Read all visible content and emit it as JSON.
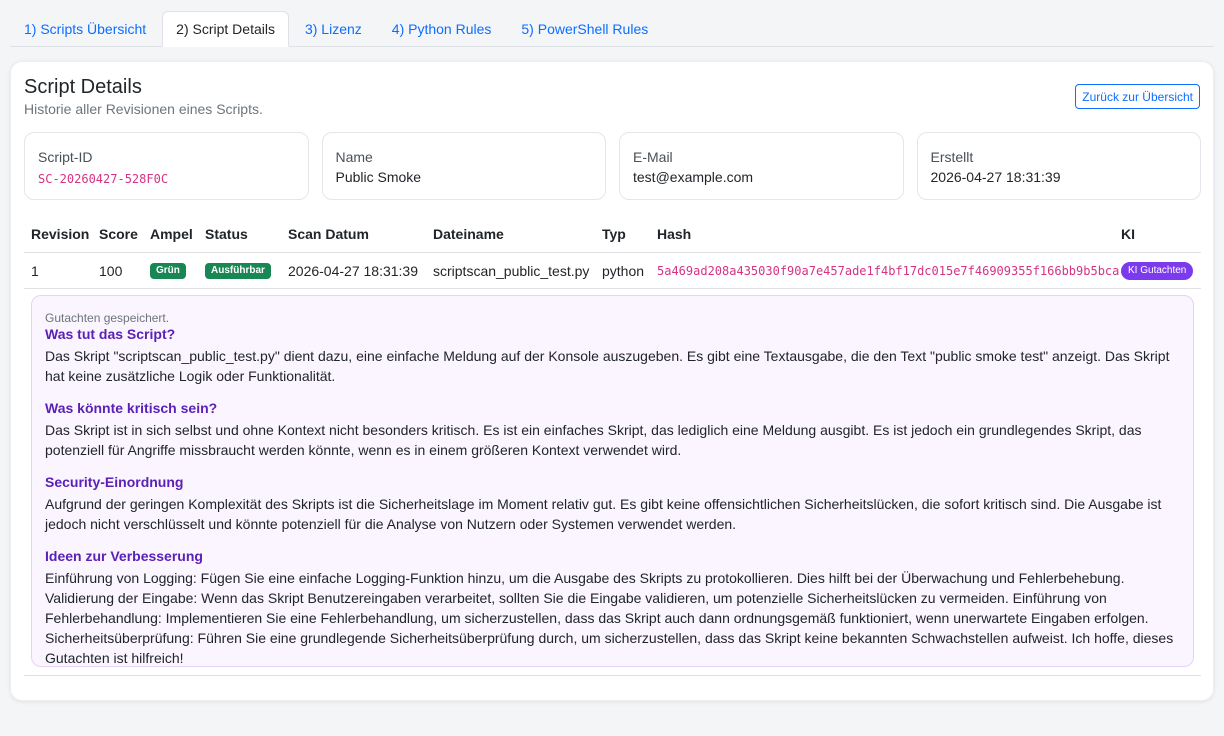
{
  "tabs": [
    {
      "label": "1) Scripts Übersicht",
      "active": false
    },
    {
      "label": "2) Script Details",
      "active": true
    },
    {
      "label": "3) Lizenz",
      "active": false
    },
    {
      "label": "4) Python Rules",
      "active": false
    },
    {
      "label": "5) PowerShell Rules",
      "active": false
    }
  ],
  "page": {
    "title": "Script Details",
    "subtitle": "Historie aller Revisionen eines Scripts.",
    "back_label": "Zurück zur Übersicht"
  },
  "info": {
    "script_id": {
      "label": "Script-ID",
      "value": "SC-20260427-528F0C"
    },
    "name": {
      "label": "Name",
      "value": "Public Smoke"
    },
    "email": {
      "label": "E-Mail",
      "value": "test@example.com"
    },
    "created": {
      "label": "Erstellt",
      "value": "2026-04-27 18:31:39"
    }
  },
  "table": {
    "headers": {
      "revision": "Revision",
      "score": "Score",
      "ampel": "Ampel",
      "status": "Status",
      "date": "Scan Datum",
      "file": "Dateiname",
      "typ": "Typ",
      "hash": "Hash",
      "ki": "KI"
    },
    "rows": [
      {
        "revision": "1",
        "score": "100",
        "ampel": "Grün",
        "status": "Ausführbar",
        "date": "2026-04-27 18:31:39",
        "file": "scriptscan_public_test.py",
        "typ": "python",
        "hash": "5a469ad208a435030f90a7e457ade1f4bf17dc015e7f46909355f166bb9b5bca",
        "ki": "KI Gutachten"
      }
    ]
  },
  "colors": {
    "accent": "#0d6efd",
    "ampel_green": "#198754",
    "ki_purple": "#7c3aed",
    "report_heading": "#5b21b6",
    "mono_pink": "#d63384"
  },
  "report": {
    "note": "Gutachten gespeichert.",
    "sections": [
      {
        "heading": "Was tut das Script?",
        "text": "Das Skript \"scriptscan_public_test.py\" dient dazu, eine einfache Meldung auf der Konsole auszugeben. Es gibt eine Textausgabe, die den Text \"public smoke test\" anzeigt. Das Skript hat keine zusätzliche Logik oder Funktionalität."
      },
      {
        "heading": "Was könnte kritisch sein?",
        "text": "Das Skript ist in sich selbst und ohne Kontext nicht besonders kritisch. Es ist ein einfaches Skript, das lediglich eine Meldung ausgibt. Es ist jedoch ein grundlegendes Skript, das potenziell für Angriffe missbraucht werden könnte, wenn es in einem größeren Kontext verwendet wird."
      },
      {
        "heading": "Security-Einordnung",
        "text": "Aufgrund der geringen Komplexität des Skripts ist die Sicherheitslage im Moment relativ gut. Es gibt keine offensichtlichen Sicherheitslücken, die sofort kritisch sind. Die Ausgabe ist jedoch nicht verschlüsselt und könnte potenziell für die Analyse von Nutzern oder Systemen verwendet werden."
      },
      {
        "heading": "Ideen zur Verbesserung",
        "text": "Einführung von Logging: Fügen Sie eine einfache Logging-Funktion hinzu, um die Ausgabe des Skripts zu protokollieren. Dies hilft bei der Überwachung und Fehlerbehebung. Validierung der Eingabe: Wenn das Skript Benutzereingaben verarbeitet, sollten Sie die Eingabe validieren, um potenzielle Sicherheitslücken zu vermeiden. Einführung von Fehlerbehandlung: Implementieren Sie eine Fehlerbehandlung, um sicherzustellen, dass das Skript auch dann ordnungsgemäß funktioniert, wenn unerwartete Eingaben erfolgen. Sicherheitsüberprüfung: Führen Sie eine grundlegende Sicherheitsüberprüfung durch, um sicherzustellen, dass das Skript keine bekannten Schwachstellen aufweist. Ich hoffe, dieses Gutachten ist hilfreich!"
      }
    ]
  }
}
